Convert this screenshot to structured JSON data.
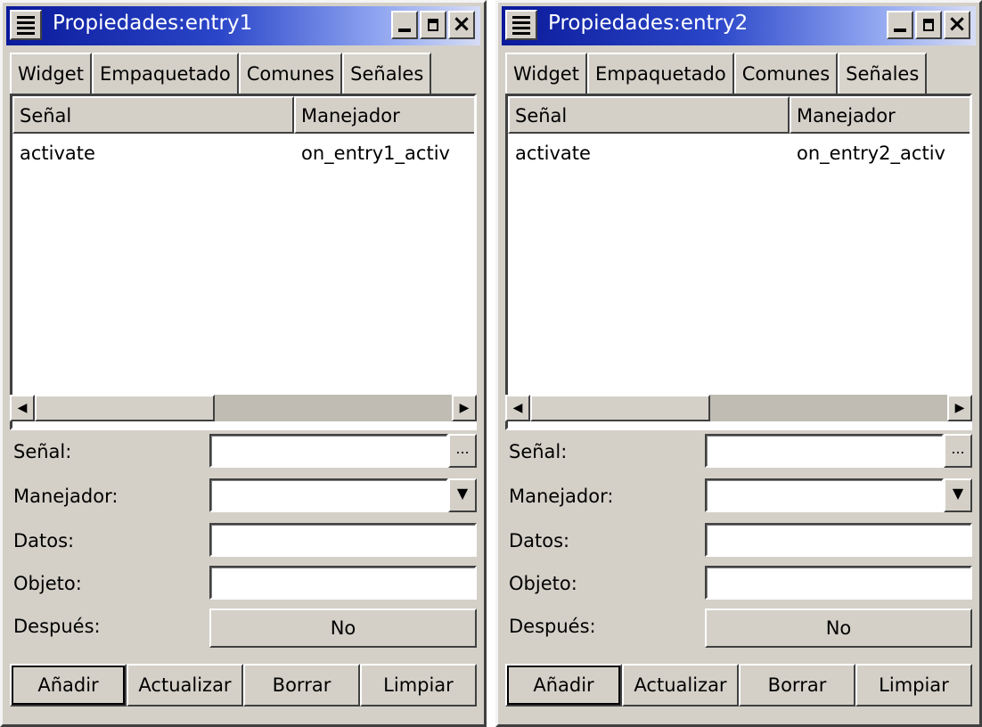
{
  "windows": [
    {
      "title": "Propiedades:entry1",
      "tabs": [
        "Widget",
        "Empaquetado",
        "Comunes",
        "Señales"
      ],
      "active_tab": "Señales",
      "columns": [
        "Señal",
        "Manejador"
      ],
      "rows": [
        [
          "activate",
          "on_entry1_activ"
        ]
      ],
      "fields": {
        "signal_label": "Señal:",
        "handler_label": "Manejador:",
        "data_label": "Datos:",
        "object_label": "Objeto:",
        "after_label": "Después:",
        "after_value": "No",
        "ellipsis": "..."
      },
      "buttons": [
        "Añadir",
        "Actualizar",
        "Borrar",
        "Limpiar"
      ]
    },
    {
      "title": "Propiedades:entry2",
      "tabs": [
        "Widget",
        "Empaquetado",
        "Comunes",
        "Señales"
      ],
      "active_tab": "Señales",
      "columns": [
        "Señal",
        "Manejador"
      ],
      "rows": [
        [
          "activate",
          "on_entry2_activ"
        ]
      ],
      "fields": {
        "signal_label": "Señal:",
        "handler_label": "Manejador:",
        "data_label": "Datos:",
        "object_label": "Objeto:",
        "after_label": "Después:",
        "after_value": "No",
        "ellipsis": "..."
      },
      "buttons": [
        "Añadir",
        "Actualizar",
        "Borrar",
        "Limpiar"
      ]
    }
  ],
  "icons": {
    "window_menu": "window-menu-icon",
    "minimize": "minimize-icon",
    "maximize": "maximize-icon",
    "close": "close-icon",
    "scroll_left": "arrow-left-icon",
    "scroll_right": "arrow-right-icon",
    "dropdown": "chevron-down-icon"
  },
  "colors": {
    "window_bg": "#d4d0c8",
    "titlebar_start": "#0a1a9a",
    "titlebar_end": "#d6dcf4",
    "list_bg": "#ffffff"
  }
}
